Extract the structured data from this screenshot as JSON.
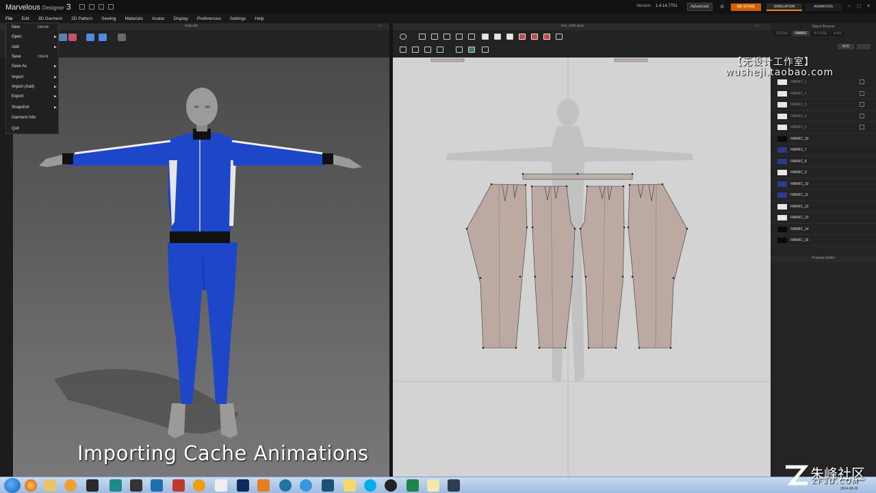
{
  "app": {
    "brand": "Marvelous",
    "sub": "Designer",
    "num": "3",
    "version_label": "Version:",
    "version_value": "1.4.14.7701",
    "advanced_label": "Advanced",
    "md_store_label": "MD STORE",
    "simulation_label": "SIMULATION",
    "animation_label": "ANIMATION"
  },
  "menubar": [
    "File",
    "Edit",
    "3D Garment",
    "2D Pattern",
    "Sewing",
    "Materials",
    "Avatar",
    "Display",
    "Preferences",
    "Settings",
    "Help"
  ],
  "file_menu": {
    "items": [
      {
        "label": "New",
        "shortcut": "Ctrl+N",
        "submenu": false
      },
      {
        "label": "Open",
        "shortcut": "",
        "submenu": true
      },
      {
        "label": "Add",
        "shortcut": "",
        "submenu": true
      },
      {
        "label": "Save",
        "shortcut": "Ctrl+S",
        "submenu": false
      },
      {
        "label": "Save As",
        "shortcut": "",
        "submenu": true
      },
      {
        "label": "Import",
        "shortcut": "",
        "submenu": true
      },
      {
        "label": "Import (Add)",
        "shortcut": "",
        "submenu": true
      },
      {
        "label": "Export",
        "shortcut": "",
        "submenu": true
      },
      {
        "label": "Snapshot",
        "shortcut": "",
        "submenu": true
      },
      {
        "label": "Garment Info",
        "shortcut": "",
        "submenu": false
      },
      {
        "label": "Quit",
        "shortcut": "",
        "submenu": false
      }
    ]
  },
  "viewport3d": {
    "file_name": "body.abc",
    "caption": "Importing Cache Animations"
  },
  "pattern2d": {
    "file_name": "test_cloth.zpac"
  },
  "object_browser": {
    "title": "Object Browser",
    "tabs": [
      "SCENE",
      "FABRIC",
      "A-POSE",
      "A-BS"
    ],
    "active_tab": "FABRIC",
    "add_label": "ADD",
    "fabrics": [
      {
        "name": "FABRIC_1",
        "color": "#e6e6e6",
        "dim": true
      },
      {
        "name": "FABRIC_2",
        "color": "#e6e6e6",
        "dim": true
      },
      {
        "name": "FABRIC_3",
        "color": "#e6e6e6",
        "dim": true
      },
      {
        "name": "FABRIC_4",
        "color": "#e6e6e6",
        "dim": true
      },
      {
        "name": "FABRIC_5",
        "color": "#e6e6e6",
        "dim": true
      },
      {
        "name": "FABRIC_10",
        "color": "#0a0a0a",
        "dim": false
      },
      {
        "name": "FABRIC_7",
        "color": "#2a3a8c",
        "dim": false
      },
      {
        "name": "FABRIC_8",
        "color": "#2a3a8c",
        "dim": false
      },
      {
        "name": "FABRIC_9",
        "color": "#e6e6e6",
        "dim": false
      },
      {
        "name": "FABRIC_10",
        "color": "#2a3a8c",
        "dim": false
      },
      {
        "name": "FABRIC_11",
        "color": "#2a3a8c",
        "dim": false
      },
      {
        "name": "FABRIC_12",
        "color": "#e6e6e6",
        "dim": false
      },
      {
        "name": "FABRIC_13",
        "color": "#e6e6e6",
        "dim": false
      },
      {
        "name": "FABRIC_14",
        "color": "#0a0a0a",
        "dim": false
      },
      {
        "name": "FABRIC_15",
        "color": "#0a0a0a",
        "dim": false
      }
    ],
    "property_editor_label": "Property Editor"
  },
  "watermark": {
    "line1": "【无设计工作室】",
    "line2": "wusheji.taobao.com",
    "zf_name": "朱峰社区",
    "zf_url": "ZF3D.COM"
  },
  "taskbar": {
    "clock": "2014-08-20"
  }
}
